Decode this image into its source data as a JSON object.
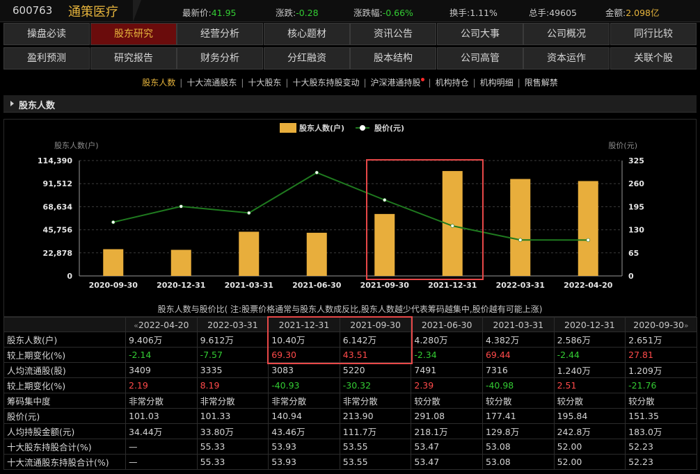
{
  "header": {
    "code": "600763",
    "name": "通策医疗",
    "quotes": [
      {
        "label": "最新价:",
        "value": "41.95",
        "cls": "g"
      },
      {
        "label": "涨跌:",
        "value": "-0.28",
        "cls": "g"
      },
      {
        "label": "涨跌幅:",
        "value": "-0.66%",
        "cls": "g"
      },
      {
        "label": "换手:",
        "value": "1.11%",
        "cls": "v"
      },
      {
        "label": "总手:",
        "value": "49605",
        "cls": "v"
      },
      {
        "label": "金额:",
        "value": "2.098亿",
        "cls": "y"
      }
    ]
  },
  "nav": {
    "row1": [
      "操盘必读",
      "股东研究",
      "经营分析",
      "核心题材",
      "资讯公告",
      "公司大事",
      "公司概况",
      "同行比较"
    ],
    "row2": [
      "盈利预测",
      "研究报告",
      "财务分析",
      "分红融资",
      "股本结构",
      "公司高管",
      "资本运作",
      "关联个股"
    ],
    "active": "股东研究"
  },
  "subtabs": {
    "items": [
      "股东人数",
      "十大流通股东",
      "十大股东",
      "十大股东持股变动",
      "沪深港通持股",
      "机构持仓",
      "机构明细",
      "限售解禁"
    ],
    "active": "股东人数",
    "separator": "|"
  },
  "section": {
    "title": "股东人数"
  },
  "chart_data": {
    "type": "bar+line",
    "legend": [
      "股东人数(户)",
      "股价(元)"
    ],
    "ylabel_left": "股东人数(户)",
    "ylabel_right": "股价(元)",
    "left_ticks": [
      "114,390",
      "91,512",
      "68,634",
      "45,756",
      "22,878",
      "0"
    ],
    "right_ticks": [
      "325",
      "260",
      "195",
      "130",
      "65",
      "0"
    ],
    "ylim_left": [
      0,
      114390
    ],
    "ylim_right": [
      0,
      325
    ],
    "categories": [
      "2020-09-30",
      "2020-12-31",
      "2021-03-31",
      "2021-06-30",
      "2021-09-30",
      "2021-12-31",
      "2022-03-31",
      "2022-04-20"
    ],
    "series": [
      {
        "name": "股东人数(户)",
        "kind": "bar",
        "color": "#e8ae3c",
        "values": [
          26510,
          25860,
          43820,
          42800,
          61420,
          104000,
          96120,
          94060
        ]
      },
      {
        "name": "股价(元)",
        "kind": "line",
        "color": "#1f7a1f",
        "values": [
          151.35,
          195.84,
          177.41,
          291.08,
          213.9,
          140.94,
          101.33,
          101.03
        ]
      }
    ],
    "caption": "股东人数与股价比( 注:股票价格通常与股东人数成反比,股东人数越少代表筹码越集中,股价越有可能上涨)"
  },
  "table": {
    "header": [
      "2022-04-20",
      "2022-03-31",
      "2021-12-31",
      "2021-09-30",
      "2021-06-30",
      "2021-03-31",
      "2020-12-31",
      "2020-09-30"
    ],
    "rows": [
      {
        "label": "股东人数(户)",
        "cells": [
          {
            "v": "9.406万",
            "c": ""
          },
          {
            "v": "9.612万",
            "c": ""
          },
          {
            "v": "10.40万",
            "c": ""
          },
          {
            "v": "6.142万",
            "c": ""
          },
          {
            "v": "4.280万",
            "c": ""
          },
          {
            "v": "4.382万",
            "c": ""
          },
          {
            "v": "2.586万",
            "c": ""
          },
          {
            "v": "2.651万",
            "c": ""
          }
        ]
      },
      {
        "label": "较上期变化(%)",
        "cells": [
          {
            "v": "-2.14",
            "c": "dn"
          },
          {
            "v": "-7.57",
            "c": "dn"
          },
          {
            "v": "69.30",
            "c": "up"
          },
          {
            "v": "43.51",
            "c": "up"
          },
          {
            "v": "-2.34",
            "c": "dn"
          },
          {
            "v": "69.44",
            "c": "up"
          },
          {
            "v": "-2.44",
            "c": "dn"
          },
          {
            "v": "27.81",
            "c": "up"
          }
        ]
      },
      {
        "label": "人均流通股(股)",
        "cells": [
          {
            "v": "3409",
            "c": ""
          },
          {
            "v": "3335",
            "c": ""
          },
          {
            "v": "3083",
            "c": ""
          },
          {
            "v": "5220",
            "c": ""
          },
          {
            "v": "7491",
            "c": ""
          },
          {
            "v": "7316",
            "c": ""
          },
          {
            "v": "1.240万",
            "c": ""
          },
          {
            "v": "1.209万",
            "c": ""
          }
        ]
      },
      {
        "label": "较上期变化(%)",
        "cells": [
          {
            "v": "2.19",
            "c": "up"
          },
          {
            "v": "8.19",
            "c": "up"
          },
          {
            "v": "-40.93",
            "c": "dn"
          },
          {
            "v": "-30.32",
            "c": "dn"
          },
          {
            "v": "2.39",
            "c": "up"
          },
          {
            "v": "-40.98",
            "c": "dn"
          },
          {
            "v": "2.51",
            "c": "up"
          },
          {
            "v": "-21.76",
            "c": "dn"
          }
        ]
      },
      {
        "label": "筹码集中度",
        "cells": [
          {
            "v": "非常分散",
            "c": ""
          },
          {
            "v": "非常分散",
            "c": ""
          },
          {
            "v": "非常分散",
            "c": ""
          },
          {
            "v": "非常分散",
            "c": ""
          },
          {
            "v": "较分散",
            "c": ""
          },
          {
            "v": "较分散",
            "c": ""
          },
          {
            "v": "较分散",
            "c": ""
          },
          {
            "v": "较分散",
            "c": ""
          }
        ]
      },
      {
        "label": "股价(元)",
        "cells": [
          {
            "v": "101.03",
            "c": ""
          },
          {
            "v": "101.33",
            "c": ""
          },
          {
            "v": "140.94",
            "c": ""
          },
          {
            "v": "213.90",
            "c": ""
          },
          {
            "v": "291.08",
            "c": ""
          },
          {
            "v": "177.41",
            "c": ""
          },
          {
            "v": "195.84",
            "c": ""
          },
          {
            "v": "151.35",
            "c": ""
          }
        ]
      },
      {
        "label": "人均持股金额(元)",
        "cells": [
          {
            "v": "34.44万",
            "c": ""
          },
          {
            "v": "33.80万",
            "c": ""
          },
          {
            "v": "43.46万",
            "c": ""
          },
          {
            "v": "111.7万",
            "c": ""
          },
          {
            "v": "218.1万",
            "c": ""
          },
          {
            "v": "129.8万",
            "c": ""
          },
          {
            "v": "242.8万",
            "c": ""
          },
          {
            "v": "183.0万",
            "c": ""
          }
        ]
      },
      {
        "label": "十大股东持股合计(%)",
        "cells": [
          {
            "v": "—",
            "c": ""
          },
          {
            "v": "55.33",
            "c": ""
          },
          {
            "v": "53.93",
            "c": ""
          },
          {
            "v": "53.55",
            "c": ""
          },
          {
            "v": "53.47",
            "c": ""
          },
          {
            "v": "53.08",
            "c": ""
          },
          {
            "v": "52.00",
            "c": ""
          },
          {
            "v": "52.23",
            "c": ""
          }
        ]
      },
      {
        "label": "十大流通股东持股合计(%)",
        "cells": [
          {
            "v": "—",
            "c": ""
          },
          {
            "v": "55.33",
            "c": ""
          },
          {
            "v": "53.93",
            "c": ""
          },
          {
            "v": "53.55",
            "c": ""
          },
          {
            "v": "53.47",
            "c": ""
          },
          {
            "v": "53.08",
            "c": ""
          },
          {
            "v": "52.00",
            "c": ""
          },
          {
            "v": "52.23",
            "c": ""
          }
        ]
      }
    ],
    "prev_arrow": "«",
    "next_arrow": "»"
  },
  "colors": {
    "accent": "#e6b43c",
    "nav_active_bg": "#6a0c0c",
    "highlight": "#e84848",
    "up": "#ff4a4a",
    "down": "#33cc33"
  }
}
